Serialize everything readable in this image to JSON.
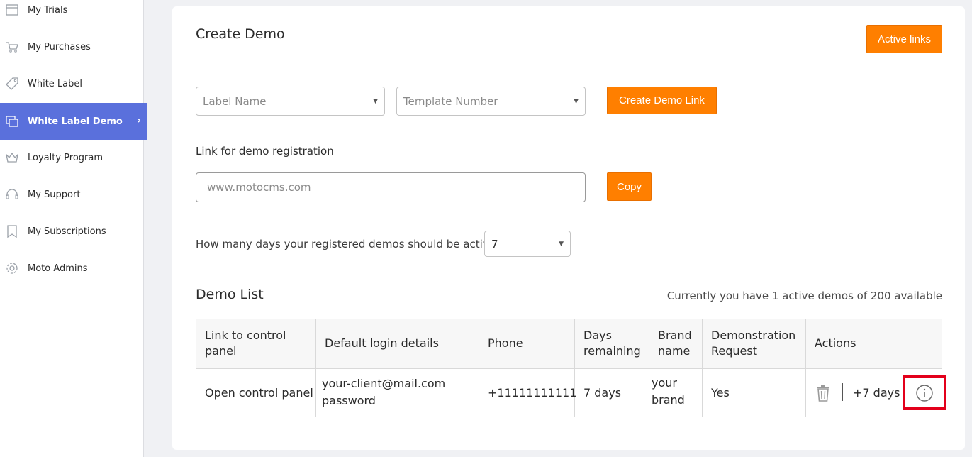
{
  "sidebar": {
    "items": [
      {
        "label": "My Trials",
        "icon": "browser-window-icon"
      },
      {
        "label": "My Purchases",
        "icon": "cart-icon"
      },
      {
        "label": "White Label",
        "icon": "tag-icon"
      },
      {
        "label": "White Label Demo",
        "icon": "windows-icon",
        "active": true
      },
      {
        "label": "Loyalty Program",
        "icon": "crown-icon"
      },
      {
        "label": "My Support",
        "icon": "headset-icon"
      },
      {
        "label": "My Subscriptions",
        "icon": "bookmark-icon"
      },
      {
        "label": "Moto Admins",
        "icon": "gear-icon"
      }
    ],
    "active_chevron": "›"
  },
  "create": {
    "title": "Create Demo",
    "active_links_label": "Active links",
    "label_name_placeholder": "Label Name",
    "template_number_placeholder": "Template Number",
    "create_link_label": "Create Demo Link",
    "registration_label": "Link for demo registration",
    "registration_url": "www.motocms.com",
    "copy_label": "Copy",
    "days_question": "How many days your registered demos should be active?",
    "days_value": "7"
  },
  "demo_list": {
    "title": "Demo List",
    "summary": "Currently you have 1 active demos of 200 available",
    "headers": {
      "link_line1": "Link to control",
      "link_line2": "panel",
      "login": "Default login details",
      "phone": "Phone",
      "days_line1": "Days",
      "days_line2": "remaining",
      "brand_line1": "Brand",
      "brand_line2": "name",
      "request_line1": "Demonstration",
      "request_line2": "Request",
      "actions": "Actions"
    },
    "rows": [
      {
        "link": "Open control panel",
        "email": "your-client@mail.com",
        "password": "password",
        "phone": "+11111111111",
        "days": "7 days",
        "brand_line1": "your",
        "brand_line2": "brand",
        "request": "Yes",
        "extend": "+7 days"
      }
    ]
  },
  "colors": {
    "accent_orange": "#ff7f00",
    "sidebar_active": "#5a70dc",
    "highlight": "#e3001b"
  }
}
